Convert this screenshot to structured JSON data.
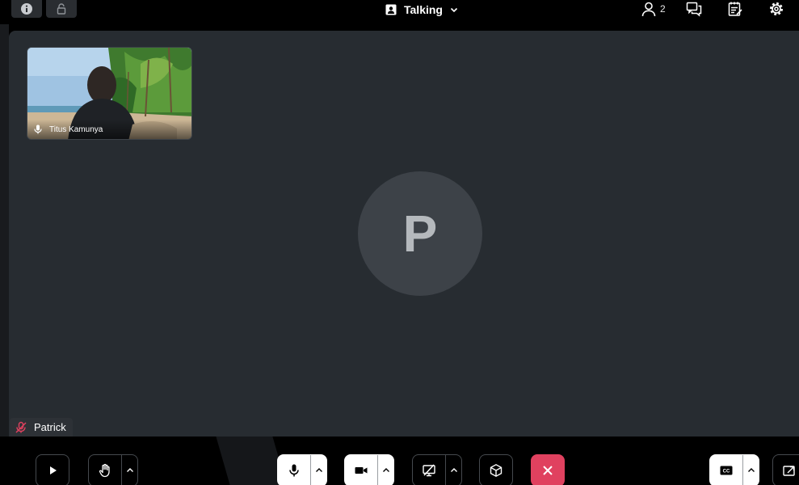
{
  "header": {
    "title": "Talking",
    "participant_count": "2",
    "icons": [
      "info-icon",
      "lock-icon",
      "presentation-icon",
      "chevron-down-icon",
      "person-icon",
      "chat-icon",
      "notes-icon",
      "gear-icon"
    ]
  },
  "stage": {
    "remote_tile": {
      "name": "Titus Kamunya",
      "mic_state": "on"
    },
    "local_avatar_letter": "P",
    "local_name": "Patrick",
    "local_mic_state": "muted"
  },
  "toolbar": {
    "cc_label": "CC",
    "buttons": [
      "play",
      "raise-hand",
      "microphone",
      "camera",
      "screen-share",
      "apps",
      "leave",
      "captions",
      "popout"
    ]
  },
  "colors": {
    "stage_bg": "#272c31",
    "avatar_bg": "#3d4248",
    "leave_button": "#e0415f",
    "muted_icon": "#e0415f"
  }
}
